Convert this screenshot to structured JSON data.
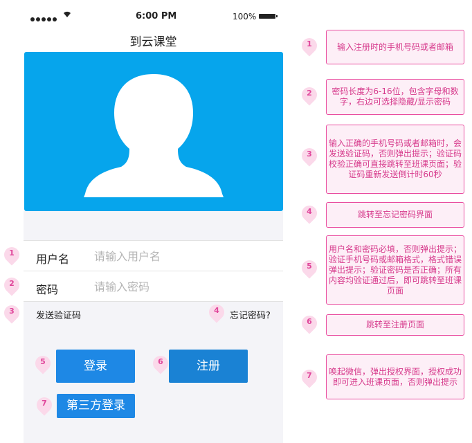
{
  "status_bar": {
    "time": "6:00 PM",
    "battery": "100%"
  },
  "app": {
    "title": "到云课堂"
  },
  "form": {
    "username_label": "用户名",
    "username_placeholder": "请输入用户名",
    "password_label": "密码",
    "password_placeholder": "请输入密码",
    "send_code": "发送验证码",
    "forgot": "忘记密码?"
  },
  "buttons": {
    "login": "登录",
    "register": "注册",
    "third_party": "第三方登录"
  },
  "markers": [
    "1",
    "2",
    "3",
    "4",
    "5",
    "6",
    "7"
  ],
  "notes": [
    "输入注册时的手机号码或者邮箱",
    "密码长度为6-16位，包含字母和数字，右边可选择隐藏/显示密码",
    "输入正确的手机号码或者邮箱时，会发送验证码，否则弹出提示；验证码校验正确可直接跳转至班课页面；验证码重新发送倒计时60秒",
    "跳转至忘记密码界面",
    "用户名和密码必填，否则弹出提示；验证手机号码或邮箱格式，格式错误弹出提示；验证密码是否正确；所有内容均验证通过后，即可跳转至班课页面",
    "跳转至注册页面",
    "唤起微信，弹出授权界面，授权成功即可进入班课页面，否则弹出提示"
  ],
  "colors": {
    "hero": "#06a5ec",
    "button": "#1e88e5",
    "annotation": "#e94c9f"
  }
}
